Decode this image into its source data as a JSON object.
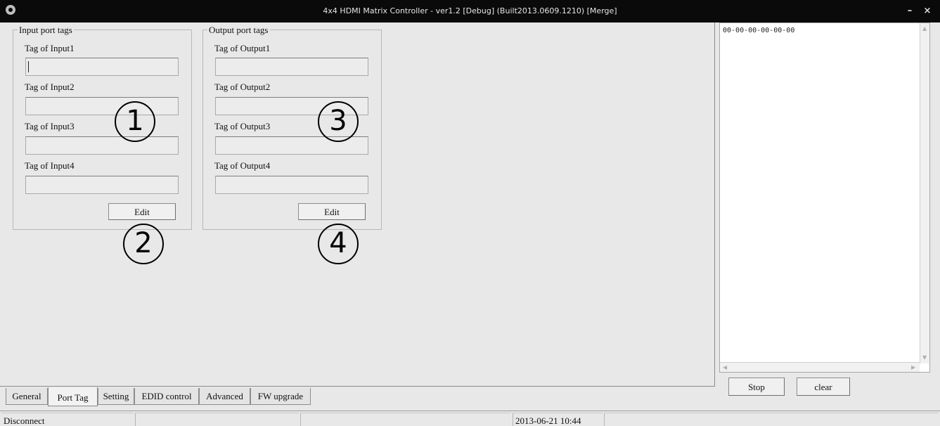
{
  "window": {
    "title": "4x4 HDMI Matrix Controller - ver1.2 [Debug]  (Built2013.0609.1210) [Merge]",
    "minimize_glyph": "–",
    "close_glyph": "×"
  },
  "input_group": {
    "legend": "Input port tags",
    "fields": [
      {
        "label": "Tag of Input1",
        "value": ""
      },
      {
        "label": "Tag of Input2",
        "value": ""
      },
      {
        "label": "Tag of Input3",
        "value": ""
      },
      {
        "label": "Tag of Input4",
        "value": ""
      }
    ],
    "edit_label": "Edit"
  },
  "output_group": {
    "legend": "Output port tags",
    "fields": [
      {
        "label": "Tag of Output1",
        "value": ""
      },
      {
        "label": "Tag of Output2",
        "value": ""
      },
      {
        "label": "Tag of Output3",
        "value": ""
      },
      {
        "label": "Tag of Output4",
        "value": ""
      }
    ],
    "edit_label": "Edit"
  },
  "callouts": [
    "1",
    "2",
    "3",
    "4"
  ],
  "tabs": [
    {
      "label": "General",
      "active": false
    },
    {
      "label": "Port Tag",
      "active": true
    },
    {
      "label": "Setting",
      "active": false
    },
    {
      "label": "EDID control",
      "active": false
    },
    {
      "label": "Advanced",
      "active": false
    },
    {
      "label": "FW upgrade",
      "active": false
    }
  ],
  "log": {
    "text": "00-00-00-00-00-00",
    "stop_label": "Stop",
    "clear_label": "clear"
  },
  "status": {
    "connection": "Disconnect",
    "datetime": "2013-06-21 10:44"
  }
}
